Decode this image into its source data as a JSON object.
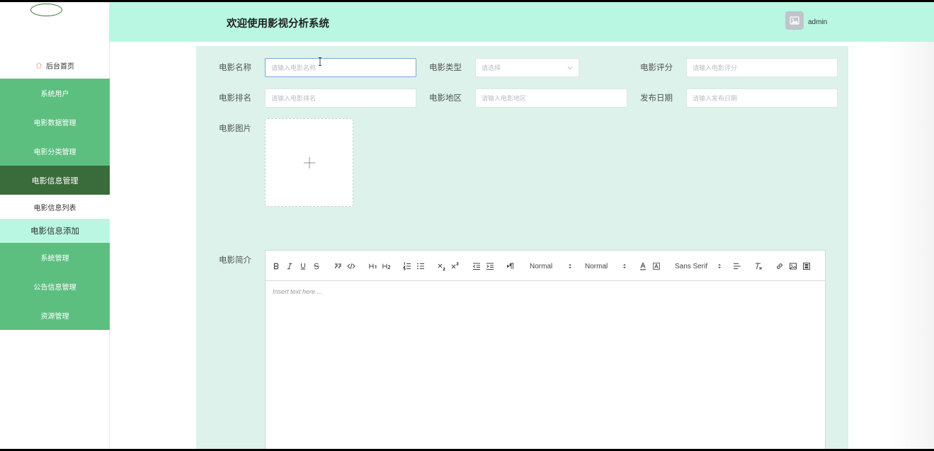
{
  "header": {
    "title": "欢迎使用影视分析系统",
    "username": "admin"
  },
  "sidebar": {
    "home": "后台首页",
    "items_top": [
      "系统用户",
      "电影数据管理",
      "电影分类管理"
    ],
    "active_item": "电影信息管理",
    "submenu": [
      "电影信息列表",
      "电影信息添加"
    ],
    "items_bottom": [
      "系统管理",
      "公告信息管理",
      "资源管理"
    ]
  },
  "form": {
    "name_label": "电影名称",
    "name_placeholder": "请输入电影名称",
    "type_label": "电影类型",
    "type_placeholder": "请选择",
    "score_label": "电影评分",
    "score_placeholder": "请输入电影评分",
    "rank_label": "电影排名",
    "rank_placeholder": "请输入电影排名",
    "region_label": "电影地区",
    "region_placeholder": "请输入电影地区",
    "date_label": "发布日期",
    "date_placeholder": "请输入发布日期",
    "image_label": "电影图片",
    "intro_label": "电影简介"
  },
  "editor": {
    "header_select": "Normal",
    "size_select": "Normal",
    "font_select": "Sans Serif",
    "placeholder": "Insert text here ..."
  },
  "colors": {
    "header_bg": "#b9f7e2",
    "sidebar_green": "#5cbf7f",
    "sidebar_active": "#3a6b3a",
    "panel_bg": "#dcf2eb"
  }
}
